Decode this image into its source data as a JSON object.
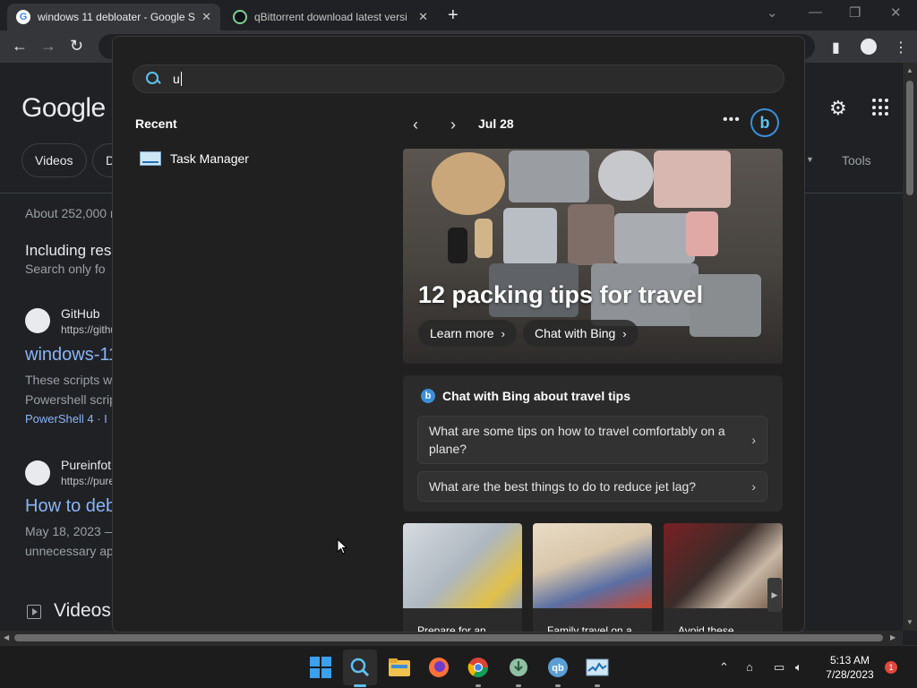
{
  "browser": {
    "tabs": [
      {
        "title": "windows 11 debloater - Google S",
        "active": true
      },
      {
        "title": "qBittorrent download latest versi",
        "active": false
      }
    ]
  },
  "google_page": {
    "logo": "Google",
    "chips": [
      "Videos",
      "D"
    ],
    "tools": "Tools",
    "result_count": "About 252,000 r",
    "including": "Including res",
    "search_only": "Search only fo",
    "results": [
      {
        "site": "GitHub",
        "url": "https://githu",
        "title": "windows-11",
        "snippet1": "These scripts w",
        "snippet2": "Powershell scrip",
        "tag": "PowerShell 4 · I"
      },
      {
        "site": "Pureinfot",
        "url": "https://pure",
        "title": "How to deb",
        "snippet1": "May 18, 2023 —",
        "snippet2": "unnecessary ap"
      }
    ],
    "videos_heading": "Videos"
  },
  "search_flyout": {
    "query": "u",
    "recent_heading": "Recent",
    "recent_items": [
      "Task Manager"
    ],
    "date": "Jul 28",
    "hero": {
      "title": "12 packing tips for travel",
      "learn_more": "Learn more",
      "chat_with_bing": "Chat with Bing"
    },
    "chat_card": {
      "heading": "Chat with Bing about travel tips",
      "questions": [
        "What are some tips on how to travel comfortably on a plane?",
        "What are the best things to do to reduce jet lag?"
      ]
    },
    "thumbnails": [
      {
        "caption": "Prepare for an"
      },
      {
        "caption": "Family travel on a"
      },
      {
        "caption": "Avoid these"
      }
    ]
  },
  "taskbar": {
    "clock_time": "5:13 AM",
    "clock_date": "7/28/2023",
    "notification_count": "1"
  }
}
